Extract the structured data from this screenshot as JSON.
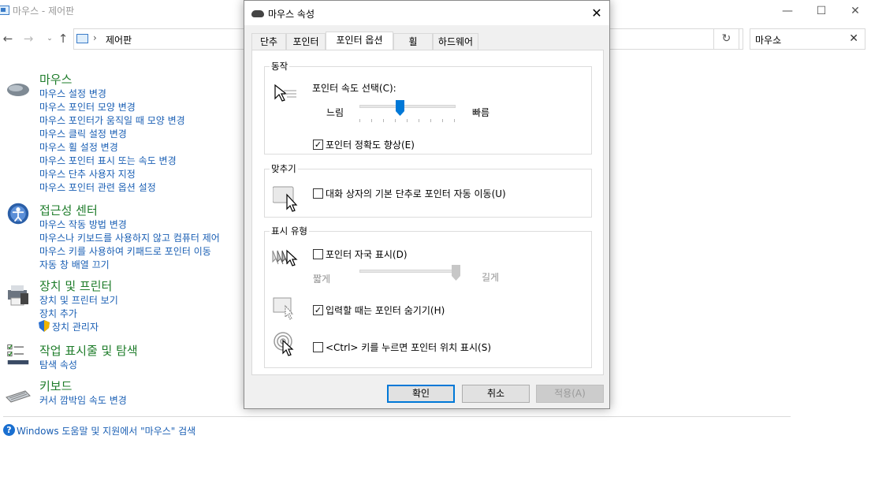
{
  "window": {
    "title": "마우스 - 제어판",
    "controls": {
      "minimize": "—",
      "maximize": "☐",
      "close": "✕"
    }
  },
  "address": {
    "back": "←",
    "forward": "→",
    "up": "↑",
    "separator": "›",
    "path": "제어판",
    "dropdown": "⌄",
    "refresh": "↻"
  },
  "search": {
    "value": "마우스",
    "clear": "✕"
  },
  "categories": [
    {
      "title": "마우스",
      "icon": "mouse-icon",
      "links": [
        "마우스 설정 변경",
        "마우스 포인터 모양 변경",
        "마우스 포인터가 움직일 때 모양 변경",
        "마우스 클릭 설정 변경",
        "마우스 휠 설정 변경",
        "마우스 포인터 표시 또는 속도 변경",
        "마우스 단추 사용자 지정",
        "마우스 포인터 관련 옵션 설정"
      ]
    },
    {
      "title": "접근성 센터",
      "icon": "ease-of-access-icon",
      "links": [
        "마우스 작동 방법 변경",
        "마우스나 키보드를 사용하지 않고 컴퓨터 제어",
        "마우스 키를 사용하여 키패드로 포인터 이동",
        "자동 창 배열 끄기"
      ]
    },
    {
      "title": "장치 및 프린터",
      "icon": "printer-icon",
      "links": [
        "장치 및 프린터 보기",
        "장치 추가",
        "장치 관리자"
      ]
    },
    {
      "title": "작업 표시줄 및 탐색",
      "icon": "taskbar-icon",
      "links": [
        "탐색 속성"
      ]
    },
    {
      "title": "키보드",
      "icon": "keyboard-icon",
      "links": [
        "커서 깜박임 속도 변경"
      ]
    }
  ],
  "help": {
    "icon": "?",
    "text": "Windows 도움말 및 지원에서 \"마우스\" 검색"
  },
  "dialog": {
    "title": "마우스 속성",
    "close": "✕",
    "tabs": [
      "단추",
      "포인터",
      "포인터 옵션",
      "휠",
      "하드웨어"
    ],
    "active_tab": "포인터 옵션",
    "motion": {
      "group_label": "동작",
      "speed_label": "포인터 속도 선택(C):",
      "slow": "느림",
      "fast": "빠름",
      "speed_value": 0.42,
      "precision_label": "포인터 정확도 향상(E)",
      "precision_checked": true
    },
    "snap": {
      "group_label": "맞추기",
      "snap_label": "대화 상자의 기본 단추로 포인터 자동 이동(U)",
      "snap_checked": false
    },
    "visibility": {
      "group_label": "표시 유형",
      "trails_label": "포인터 자국 표시(D)",
      "trails_checked": false,
      "short": "짧게",
      "long": "길게",
      "trails_value": 1.0,
      "hide_label": "입력할 때는 포인터 숨기기(H)",
      "hide_checked": true,
      "ctrl_label": "<Ctrl> 키를 누르면 포인터 위치 표시(S)",
      "ctrl_checked": false
    },
    "buttons": {
      "ok": "확인",
      "cancel": "취소",
      "apply": "적용(A)"
    }
  },
  "check_mark": "✓",
  "colors": {
    "link": "#1a5fb4",
    "category": "#1e7c2a",
    "accent": "#0078d7"
  }
}
